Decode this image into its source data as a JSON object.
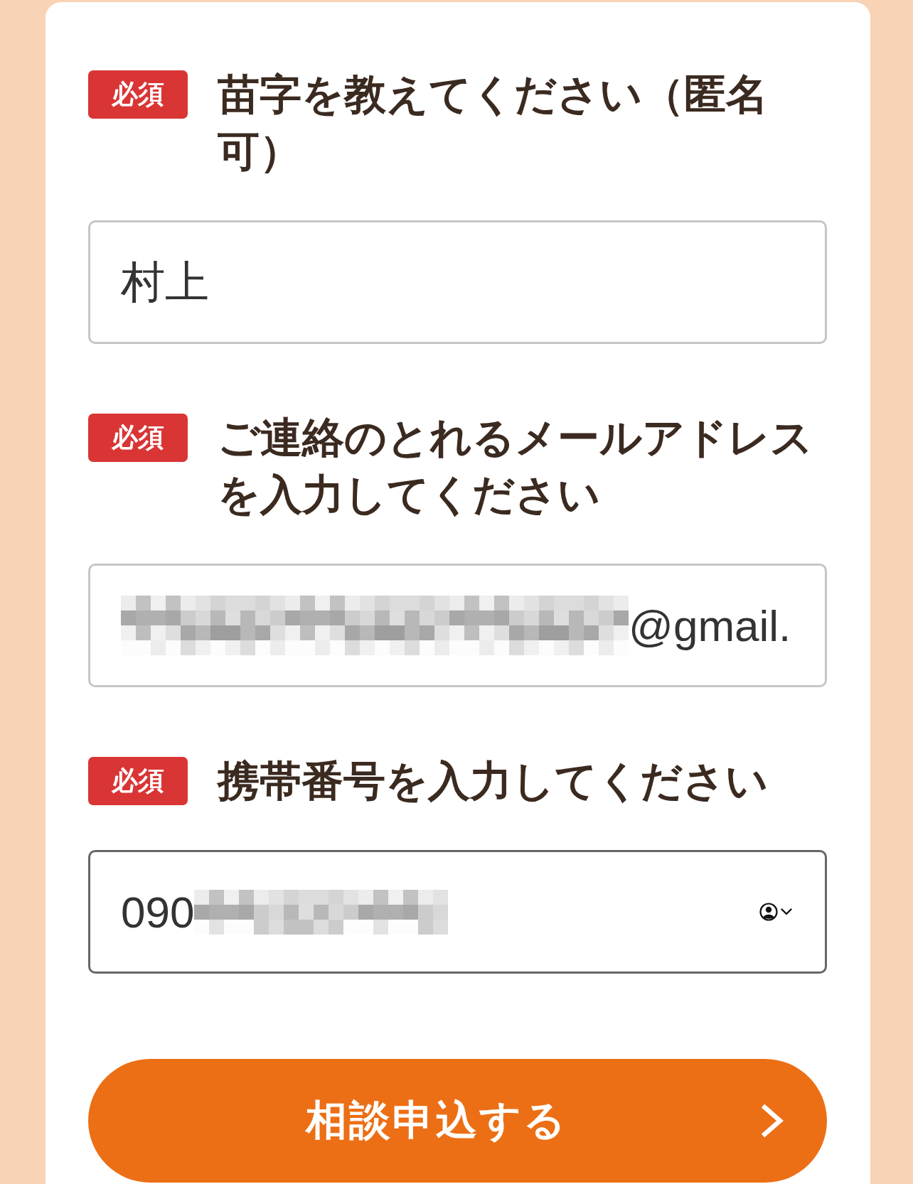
{
  "sections": [
    {
      "badge": "必須",
      "question": "苗字を教えてください（匿名可）",
      "field": {
        "kind": "text",
        "focused": false,
        "contact_autofill": false,
        "value_parts": [
          {
            "kind": "text",
            "text": "村上"
          }
        ]
      }
    },
    {
      "badge": "必須",
      "question": "ご連絡のとれるメールアドレスを入力してください",
      "field": {
        "kind": "email",
        "focused": false,
        "contact_autofill": false,
        "value_parts": [
          {
            "kind": "redacted"
          },
          {
            "kind": "text",
            "text": "@gmail."
          }
        ]
      }
    },
    {
      "badge": "必須",
      "question": "携帯番号を入力してください",
      "field": {
        "kind": "tel",
        "focused": true,
        "contact_autofill": true,
        "value_parts": [
          {
            "kind": "text",
            "text": "090"
          },
          {
            "kind": "redacted"
          }
        ]
      }
    }
  ],
  "submit_button": {
    "label": "相談申込する"
  }
}
